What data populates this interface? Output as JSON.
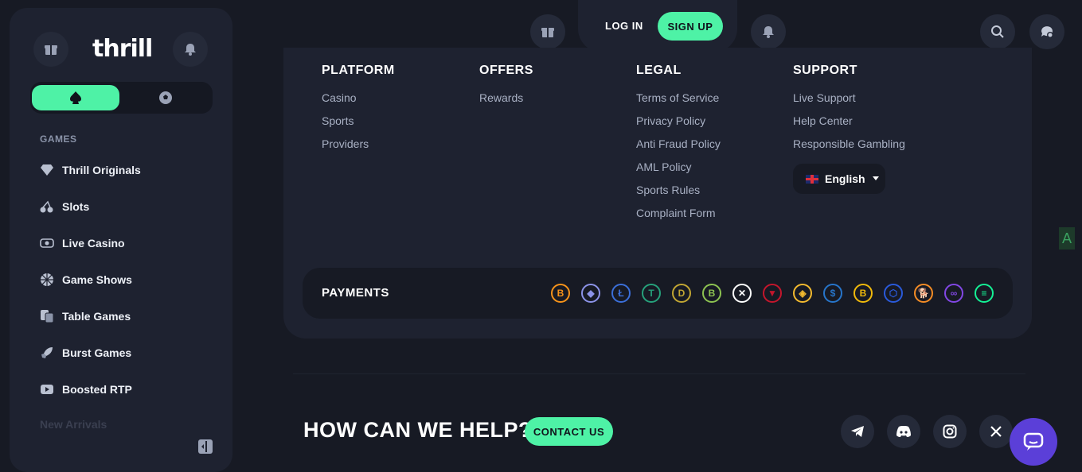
{
  "sidebar": {
    "logo": "thrill",
    "section_title": "GAMES",
    "items": [
      {
        "label": "Thrill Originals",
        "icon": "diamond-icon"
      },
      {
        "label": "Slots",
        "icon": "cherry-icon"
      },
      {
        "label": "Live Casino",
        "icon": "live-icon"
      },
      {
        "label": "Game Shows",
        "icon": "wheel-icon"
      },
      {
        "label": "Table Games",
        "icon": "cards-icon"
      },
      {
        "label": "Burst Games",
        "icon": "rocket-icon"
      },
      {
        "label": "Boosted RTP",
        "icon": "boost-icon"
      }
    ],
    "faded_item": "New Arrivals"
  },
  "topbar": {
    "login": "LOG IN",
    "signup": "SIGN UP"
  },
  "footer": {
    "columns": [
      {
        "title": "PLATFORM",
        "links": [
          "Casino",
          "Sports",
          "Providers"
        ]
      },
      {
        "title": "OFFERS",
        "links": [
          "Rewards"
        ]
      },
      {
        "title": "LEGAL",
        "links": [
          "Terms of Service",
          "Privacy Policy",
          "Anti Fraud Policy",
          "AML Policy",
          "Sports Rules",
          "Complaint Form"
        ]
      },
      {
        "title": "SUPPORT",
        "links": [
          "Live Support",
          "Help Center",
          "Responsible Gambling"
        ]
      }
    ],
    "language": "English",
    "payments_label": "PAYMENTS",
    "coins": [
      {
        "sym": "B",
        "color": "#f7931a"
      },
      {
        "sym": "◆",
        "color": "#8c93e8"
      },
      {
        "sym": "Ł",
        "color": "#3b6fd9"
      },
      {
        "sym": "T",
        "color": "#26a17b"
      },
      {
        "sym": "D",
        "color": "#c2a633"
      },
      {
        "sym": "B",
        "color": "#8dc351"
      },
      {
        "sym": "✕",
        "color": "#ffffff"
      },
      {
        "sym": "▼",
        "color": "#c4162c"
      },
      {
        "sym": "◈",
        "color": "#f3ba2f"
      },
      {
        "sym": "$",
        "color": "#2775ca"
      },
      {
        "sym": "B",
        "color": "#f0b90b"
      },
      {
        "sym": "⬡",
        "color": "#2a5ada"
      },
      {
        "sym": "🐕",
        "color": "#f48c25"
      },
      {
        "sym": "∞",
        "color": "#8247e5"
      },
      {
        "sym": "≡",
        "color": "#14f195"
      }
    ]
  },
  "help": {
    "title": "HOW CAN WE HELP?",
    "contact": "CONTACT US"
  },
  "ad_tag": "A",
  "colors": {
    "accent": "#4ef2a6",
    "chat": "#5b3fd8"
  }
}
